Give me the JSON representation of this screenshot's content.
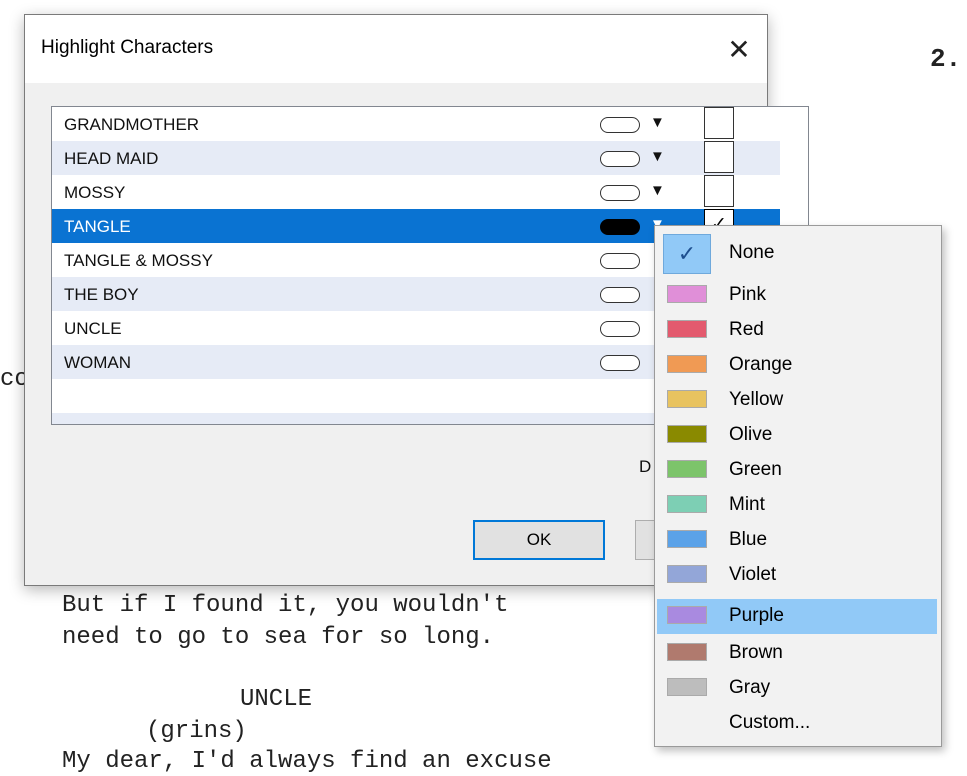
{
  "background": {
    "page_number": "2.",
    "fragment_left": "co",
    "lines": [
      "But if I found it, you wouldn't",
      "need to go to sea for so long.",
      "UNCLE",
      "(grins)",
      "My dear, I'd always find an excuse"
    ]
  },
  "dialog": {
    "title": "Highlight Characters",
    "close_icon": "close-icon",
    "characters": [
      {
        "name": "GRANDMOTHER",
        "checked": ""
      },
      {
        "name": "HEAD MAID",
        "checked": ""
      },
      {
        "name": "MOSSY",
        "checked": ""
      },
      {
        "name": "TANGLE",
        "checked": "✓"
      },
      {
        "name": "TANGLE & MOSSY",
        "checked": ""
      },
      {
        "name": "THE BOY",
        "checked": ""
      },
      {
        "name": "UNCLE",
        "checked": ""
      },
      {
        "name": "WOMAN",
        "checked": ""
      }
    ],
    "selected_row": "TANGLE",
    "partial_label": "D",
    "ok_label": "OK"
  },
  "color_menu": {
    "items": [
      {
        "label": "None",
        "color": "",
        "checked": "✓"
      },
      {
        "label": "Pink",
        "color": "#e08fd8"
      },
      {
        "label": "Red",
        "color": "#e35a6e"
      },
      {
        "label": "Orange",
        "color": "#f09a54"
      },
      {
        "label": "Yellow",
        "color": "#e8c360"
      },
      {
        "label": "Olive",
        "color": "#8a8a00"
      },
      {
        "label": "Green",
        "color": "#7cc46a"
      },
      {
        "label": "Mint",
        "color": "#7dcfb4"
      },
      {
        "label": "Blue",
        "color": "#5ba2e8"
      },
      {
        "label": "Violet",
        "color": "#93a6d8"
      },
      {
        "label": "Purple",
        "color": "#a98ae0"
      },
      {
        "label": "Brown",
        "color": "#b07a6e"
      },
      {
        "label": "Gray",
        "color": "#bdbdbd"
      },
      {
        "label": "Custom...",
        "color": ""
      }
    ],
    "highlighted": "Purple"
  }
}
